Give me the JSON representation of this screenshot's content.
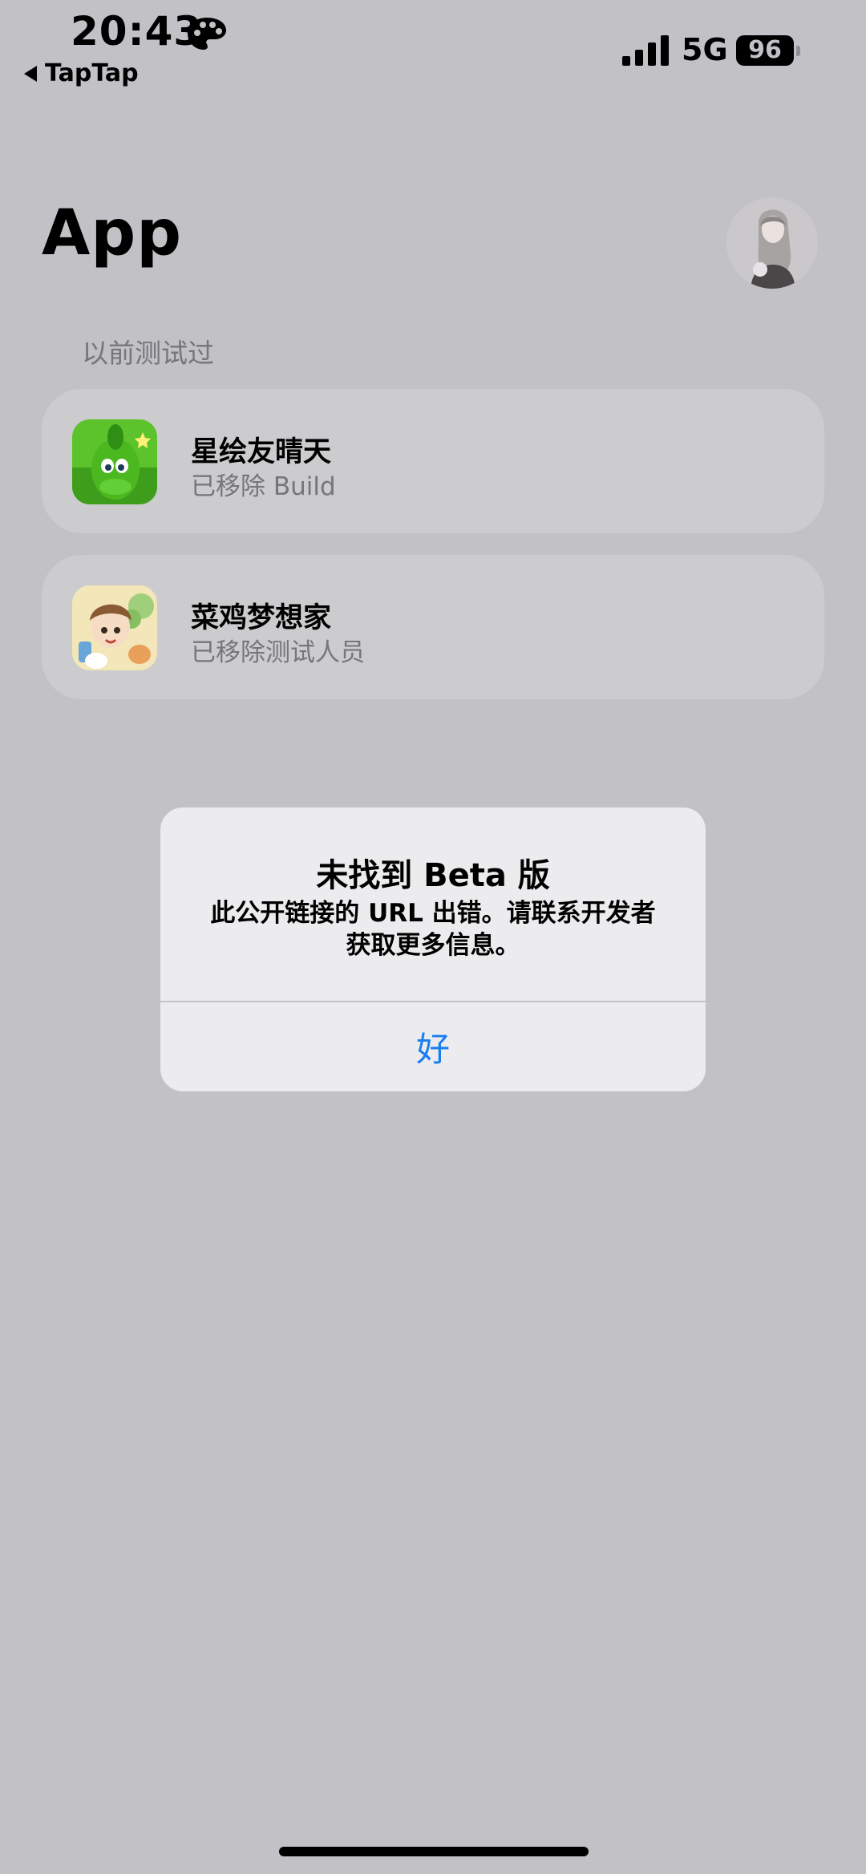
{
  "status_bar": {
    "time": "20:43",
    "back_app": "TapTap",
    "network": "5G",
    "battery": "96",
    "extra_icon": "palette-icon",
    "signal_icon": "cellular-signal-icon"
  },
  "header": {
    "title": "App",
    "avatar_icon": "profile-avatar"
  },
  "section": {
    "label": "以前测试过"
  },
  "apps": [
    {
      "name": "星绘友晴天",
      "status": "已移除 Build"
    },
    {
      "name": "菜鸡梦想家",
      "status": "已移除测试人员"
    }
  ],
  "alert": {
    "title": "未找到 Beta 版",
    "message_line1": "此公开链接的 URL 出错。请联系开发者",
    "message_line2": "获取更多信息。",
    "ok_label": "好",
    "ok_color": "#1a7ef0"
  }
}
